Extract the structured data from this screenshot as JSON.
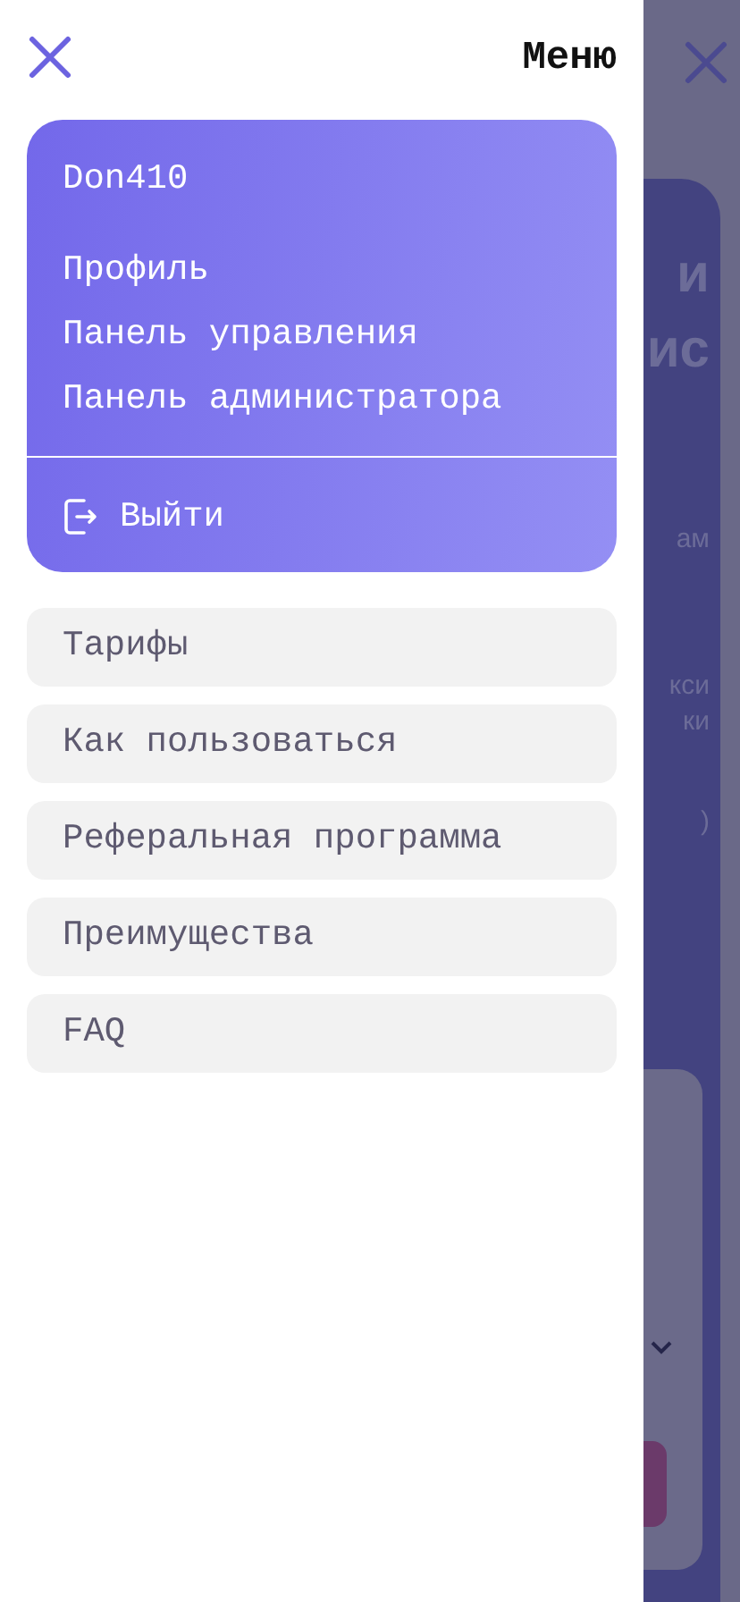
{
  "drawer": {
    "title": "Меню",
    "account": {
      "username": "Don410",
      "links": [
        "Профиль",
        "Панель управления",
        "Панель администратора"
      ],
      "logout": "Выйти"
    },
    "menu": [
      "Тарифы",
      "Как пользоваться",
      "Реферальная программа",
      "Преимущества",
      "FAQ"
    ]
  },
  "background_page": {
    "fragments": [
      {
        "kind": "heading",
        "text": "и"
      },
      {
        "kind": "heading",
        "text": "ис"
      },
      {
        "kind": "text",
        "text": "ам"
      },
      {
        "kind": "text",
        "text": "кси"
      },
      {
        "kind": "text",
        "text": "ки"
      },
      {
        "kind": "text",
        "text": ")"
      }
    ]
  }
}
